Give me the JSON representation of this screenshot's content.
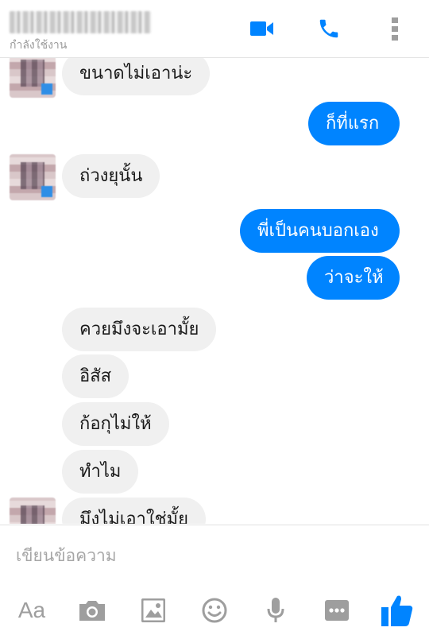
{
  "header": {
    "contact_name": "",
    "status": "กำลังใช้งาน",
    "buttons": [
      "video-call",
      "voice-call",
      "more-options"
    ]
  },
  "colors": {
    "accent": "#0084ff",
    "incoming_bubble": "#f0f0f0",
    "icon_gray": "#9e9e9e"
  },
  "messages": [
    {
      "side": "in",
      "text": "ขนาดไม่เอาน่ะ",
      "avatar": true
    },
    {
      "side": "out",
      "text": "ก็ที่แรก"
    },
    {
      "side": "in",
      "text": "ถ่วงยุนั้น",
      "avatar": true
    },
    {
      "side": "out",
      "text": "พี่เป็นคนบอกเอง"
    },
    {
      "side": "out",
      "text": "ว่าจะให้"
    },
    {
      "side": "in",
      "text": "ควยมึงจะเอามั้ย"
    },
    {
      "side": "in",
      "text": "อิสัส"
    },
    {
      "side": "in",
      "text": "ก้อกุไม่ให้"
    },
    {
      "side": "in",
      "text": "ทำไม"
    },
    {
      "side": "in",
      "text": "มึงไม่เอาใช่มั้ย",
      "avatar": true
    }
  ],
  "composer": {
    "placeholder": "เขียนข้อความ"
  },
  "toolbar": {
    "text_style_label": "Aa",
    "icons": [
      "camera-icon",
      "image-icon",
      "emoji-icon",
      "microphone-icon",
      "more-icon",
      "thumbs-up-icon"
    ]
  }
}
